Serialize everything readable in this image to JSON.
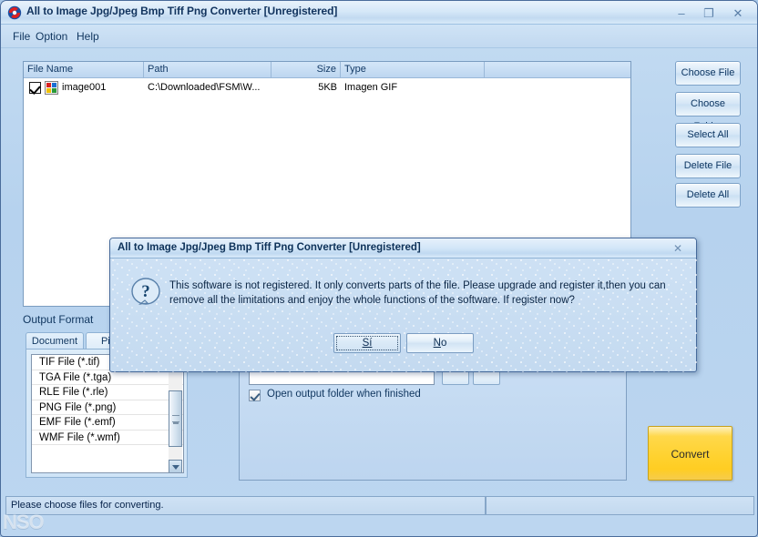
{
  "window": {
    "title": "All to Image Jpg/Jpeg Bmp Tiff Png Converter [Unregistered]",
    "icon": "app-logo-icon",
    "minimize": "–",
    "maximize": "❐",
    "close": "✕"
  },
  "menubar": {
    "items": [
      {
        "label": "File"
      },
      {
        "label": "Option"
      },
      {
        "label": "Help"
      }
    ]
  },
  "filelist": {
    "columns": [
      "File Name",
      "Path",
      "Size",
      "Type",
      ""
    ],
    "rows": [
      {
        "checked": true,
        "file_name": "image001",
        "path": "C:\\Downloaded\\FSM\\W...",
        "size": "5KB",
        "type": "Imagen GIF"
      }
    ]
  },
  "side_buttons": [
    {
      "label": "Choose File"
    },
    {
      "label": "Choose Folder"
    },
    {
      "label": "Select All"
    },
    {
      "label": "Delete File"
    },
    {
      "label": "Delete All"
    }
  ],
  "output_format": {
    "group_label": "Output Format",
    "tabs": [
      {
        "label": "Document",
        "selected": true
      },
      {
        "label": "Pictur",
        "selected": false
      }
    ],
    "formats": [
      "TIF File  (*.tif)",
      "TGA File  (*.tga)",
      "RLE File  (*.rle)",
      "PNG File  (*.png)",
      "EMF File  (*.emf)",
      "WMF File  (*.wmf)"
    ]
  },
  "settings": {
    "output_path_value": "",
    "output_path_placeholder": "",
    "browse_label": "",
    "open_label": "",
    "open_output_folder_label": "Open output folder when finished",
    "open_output_folder_checked": true
  },
  "convert": {
    "label": "Convert",
    "color": "#ffd230"
  },
  "statusbar": {
    "message": "Please choose files for converting.",
    "right_panel": ""
  },
  "watermark": {
    "text": "NSO"
  },
  "dialog": {
    "title": "All to Image Jpg/Jpeg Bmp Tiff Png Converter [Unregistered]",
    "close": "✕",
    "icon": "question-mark-icon",
    "message": "This software is not registered. It only converts parts of the file. Please upgrade and register it,then you can remove all the limitations and enjoy the whole functions of the software. If register now?",
    "yes_label": "Sí",
    "no_label": "No"
  }
}
